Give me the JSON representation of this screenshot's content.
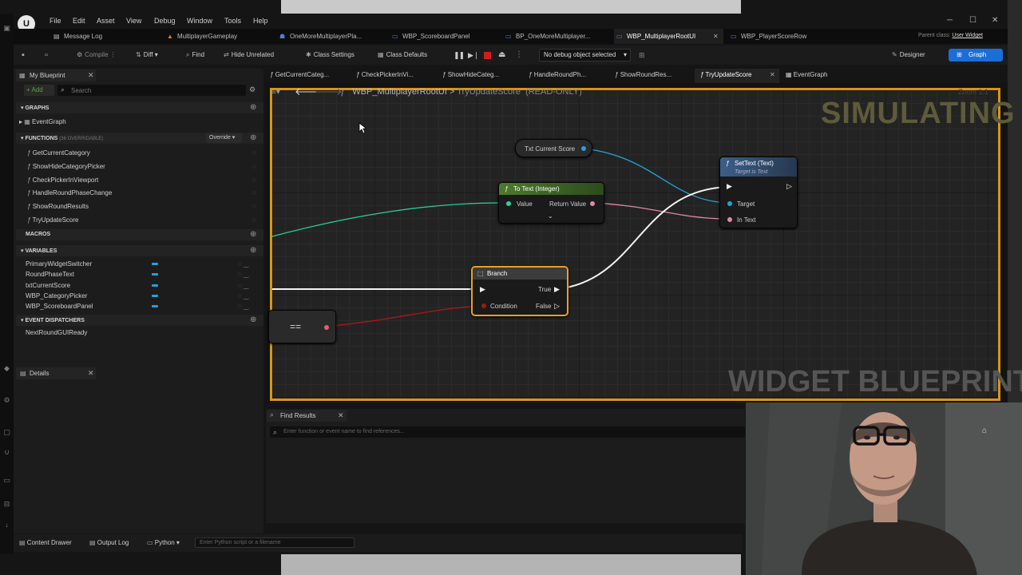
{
  "menu": [
    "File",
    "Edit",
    "Asset",
    "View",
    "Debug",
    "Window",
    "Tools",
    "Help"
  ],
  "doc_tabs": [
    {
      "label": "Message Log",
      "color": "#b0b0b0",
      "icon": "▤"
    },
    {
      "label": "MultiplayerGameplay",
      "color": "#e07a2c",
      "icon": "▲"
    },
    {
      "label": "OneMoreMultiplayerPla...",
      "color": "#4f7fd8",
      "icon": "☗"
    },
    {
      "label": "WBP_ScoreboardPanel",
      "color": "#4f7fd8",
      "icon": "▭"
    },
    {
      "label": "BP_OneMoreMultiplayer...",
      "color": "#4f7fd8",
      "icon": "▭"
    },
    {
      "label": "WBP_MultiplayerRootUI",
      "color": "#4f7fd8",
      "icon": "▭"
    },
    {
      "label": "WBP_PlayerScoreRow",
      "color": "#4f7fd8",
      "icon": "▭"
    }
  ],
  "parent_class": {
    "label": "Parent class:",
    "value": "User Widget"
  },
  "toolbar": {
    "compile": "Compile",
    "diff": "Diff",
    "find": "Find",
    "hide_unrelated": "Hide Unrelated",
    "class_settings": "Class Settings",
    "class_defaults": "Class Defaults",
    "debug_select": "No debug object selected",
    "designer": "Designer",
    "graph": "Graph"
  },
  "my_blueprint": {
    "tab": "My Blueprint",
    "add": "+ Add",
    "search_placeholder": "Search",
    "graphs_header": "GRAPHS",
    "graphs": [
      "EventGraph"
    ],
    "functions_header": "FUNCTIONS",
    "functions_note": "(36 OVERRIDABLE)",
    "override": "Override",
    "functions": [
      "GetCurrentCategory",
      "ShowHideCategoryPicker",
      "CheckPickerInViewport",
      "HandleRoundPhaseChange",
      "ShowRoundResults",
      "TryUpdateScore"
    ],
    "macros_header": "MACROS",
    "variables_header": "VARIABLES",
    "variables": [
      "PrimaryWidgetSwitcher",
      "RoundPhaseText",
      "txtCurrentScore",
      "WBP_CategoryPicker",
      "WBP_ScoreboardPanel"
    ],
    "dispatchers_header": "EVENT DISPATCHERS",
    "dispatchers": [
      "NextRoundGUIReady"
    ]
  },
  "details": {
    "tab": "Details"
  },
  "graph_tabs": [
    "GetCurrentCateg...",
    "CheckPickerInVi...",
    "ShowHideCateg...",
    "HandleRoundPh...",
    "ShowRoundRes...",
    "TryUpdateScore",
    "EventGraph"
  ],
  "breadcrumb": {
    "root": "WBP_MultiplayerRootUI",
    "sep": ">",
    "func": "TryUpdateScore",
    "mode": "(READ-ONLY)",
    "zoom": "Zoom 1:1"
  },
  "overlay": {
    "simulating": "SIMULATING",
    "type": "WIDGET BLUEPRINT"
  },
  "nodes": {
    "txt_score": {
      "label": "Txt Current Score"
    },
    "to_text": {
      "title": "To Text (Integer)",
      "in": "Value",
      "out": "Return Value"
    },
    "set_text": {
      "title": "SetText (Text)",
      "subtitle": "Target is Text",
      "target": "Target",
      "in_text": "In Text"
    },
    "branch": {
      "title": "Branch",
      "condition": "Condition",
      "true": "True",
      "false": "False"
    },
    "equals": {
      "label": "=="
    }
  },
  "find_results": {
    "tab": "Find Results",
    "placeholder": "Enter function or event name to find references..."
  },
  "statusbar": {
    "content_drawer": "Content Drawer",
    "output_log": "Output Log",
    "python": "Python",
    "cmd_placeholder": "Enter Python script or a filename"
  },
  "colors": {
    "accent": "#1a6ed8",
    "simulating_border": "#d7951c",
    "function_header": "#3b5f8a",
    "pure_header": "#4e7a2c",
    "text_pin": "#e088a8",
    "object_pin": "#28a0d8",
    "int_pin": "#2ad0a0",
    "bool_pin": "#a01818"
  }
}
